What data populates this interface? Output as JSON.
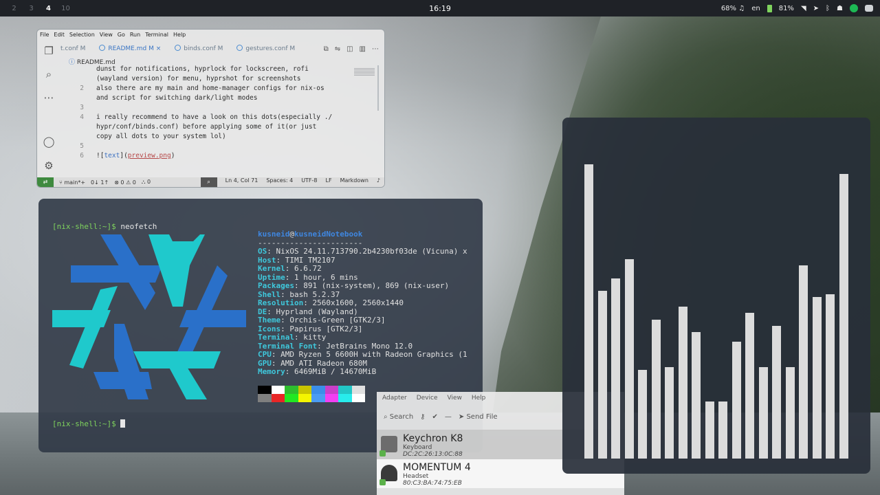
{
  "topbar": {
    "workspaces": [
      "2",
      "3",
      "4",
      "10"
    ],
    "active_workspace": "4",
    "clock": "16:19",
    "volume": "68%",
    "keyboard_layout": "en",
    "battery": "81%"
  },
  "vscode": {
    "menu": [
      "File",
      "Edit",
      "Selection",
      "View",
      "Go",
      "Run",
      "Terminal",
      "Help"
    ],
    "tabs": [
      {
        "label": "t.conf",
        "badge": "M"
      },
      {
        "label": "README.md",
        "badge": "M"
      },
      {
        "label": "binds.conf",
        "badge": "M"
      },
      {
        "label": "gestures.conf",
        "badge": "M"
      }
    ],
    "breadcrumb": "README.md",
    "code_lines": [
      {
        "num": "",
        "text": "dunst for notifications, hyprlock for lockscreen, rofi"
      },
      {
        "num": "",
        "text": "(wayland version) for menu, hyprshot for screenshots"
      },
      {
        "num": "2",
        "text": "also there are my main and home-manager configs for nix-os"
      },
      {
        "num": "",
        "text": "and script for switching dark/light modes"
      },
      {
        "num": "3",
        "text": ""
      },
      {
        "num": "4",
        "text": "i really recommend to have a look on this dots(especially ./"
      },
      {
        "num": "",
        "text": "hypr/conf/binds.conf) before applying some of it(or just"
      },
      {
        "num": "",
        "text": "copy all dots to your system lol)"
      },
      {
        "num": "5",
        "text": ""
      }
    ],
    "image_line": {
      "num": "6",
      "prefix": "![",
      "alt": "text",
      "mid": "](",
      "src": "preview.png",
      "suffix": ")"
    },
    "status": {
      "branch": "main*+",
      "sync": "0↓ 1↑",
      "problems": "⊗ 0 ⚠ 0",
      "ports": "⛬ 0",
      "position": "Ln 4, Col 71",
      "spaces": "Spaces: 4",
      "encoding": "UTF-8",
      "eol": "LF",
      "language": "Markdown"
    }
  },
  "terminal": {
    "prompt": "[nix-shell:~]$",
    "command": "neofetch",
    "user": "kusneid",
    "host": "kusneidNotebook",
    "separator": "-----------------------",
    "info": [
      {
        "key": "OS",
        "value": "NixOS 24.11.713790.2b4230bf03de (Vicuna) x"
      },
      {
        "key": "Host",
        "value": "TIMI TM2107"
      },
      {
        "key": "Kernel",
        "value": "6.6.72"
      },
      {
        "key": "Uptime",
        "value": "1 hour, 6 mins"
      },
      {
        "key": "Packages",
        "value": "891 (nix-system), 869 (nix-user)"
      },
      {
        "key": "Shell",
        "value": "bash 5.2.37"
      },
      {
        "key": "Resolution",
        "value": "2560x1600, 2560x1440"
      },
      {
        "key": "DE",
        "value": "Hyprland (Wayland)"
      },
      {
        "key": "Theme",
        "value": "Orchis-Green [GTK2/3]"
      },
      {
        "key": "Icons",
        "value": "Papirus [GTK2/3]"
      },
      {
        "key": "Terminal",
        "value": "kitty"
      },
      {
        "key": "Terminal Font",
        "value": "JetBrains Mono 12.0"
      },
      {
        "key": "CPU",
        "value": "AMD Ryzen 5 6600H with Radeon Graphics (1"
      },
      {
        "key": "GPU",
        "value": "AMD ATI Radeon 680M"
      },
      {
        "key": "Memory",
        "value": "6469MiB / 14670MiB"
      }
    ],
    "palette": [
      "#000000",
      "#ffffff",
      "#2ebd2e",
      "#c9c400",
      "#3b8ee8",
      "#c93fc9",
      "#22c6c6",
      "#e0e0e0",
      "#7f7f7f",
      "#e82626",
      "#22e822",
      "#f5f500",
      "#4a9cf2",
      "#f23ff2",
      "#28ecec",
      "#ffffff"
    ],
    "logo_colors": {
      "light": "#1fc9cc",
      "dark": "#2a70c9"
    }
  },
  "bluetooth": {
    "menu": [
      "Adapter",
      "Device",
      "View",
      "Help"
    ],
    "search": "Search",
    "send_file": "Send File",
    "devices": [
      {
        "name": "Keychron K8",
        "type": "Keyboard",
        "mac": "DC:2C:26:13:0C:88"
      },
      {
        "name": "MOMENTUM 4",
        "type": "Headset",
        "mac": "80:C3:BA:74:75:EB"
      }
    ]
  },
  "visualizer": {
    "levels": [
      0.93,
      0.53,
      0.57,
      0.63,
      0.28,
      0.44,
      0.29,
      0.48,
      0.4,
      0.18,
      0.18,
      0.37,
      0.46,
      0.29,
      0.42,
      0.29,
      0.61,
      0.51,
      0.52,
      0.9
    ],
    "bar_color": "#dcdcdc"
  }
}
